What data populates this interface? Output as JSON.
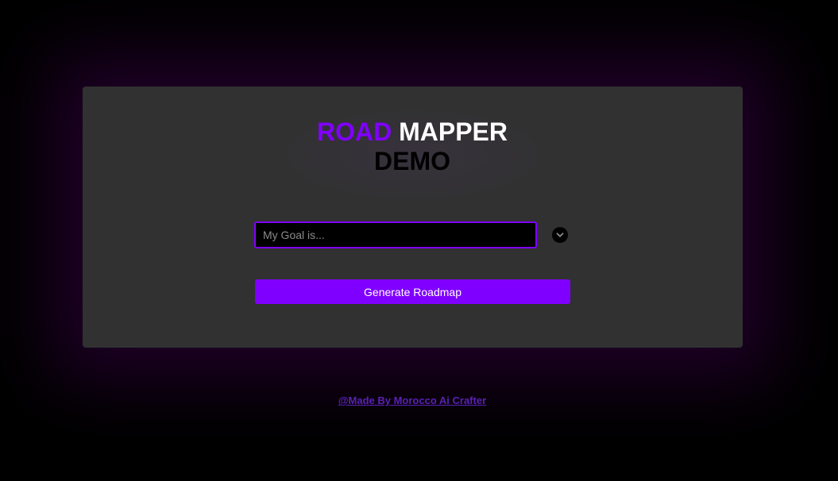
{
  "title": {
    "word1": "ROAD",
    "word2": "MAPPER",
    "word3": "DEMO"
  },
  "goal_input": {
    "placeholder": "My Goal is...",
    "value": ""
  },
  "dropdown": {
    "icon": "chevron-down-icon"
  },
  "generate_button": {
    "label": "Generate Roadmap"
  },
  "footer": {
    "link_text": "@Made By Morocco Ai Crafter"
  },
  "colors": {
    "accent": "#8000ff",
    "card_background": "#313131",
    "page_background": "#000000",
    "footer_link": "#5b21b6"
  }
}
